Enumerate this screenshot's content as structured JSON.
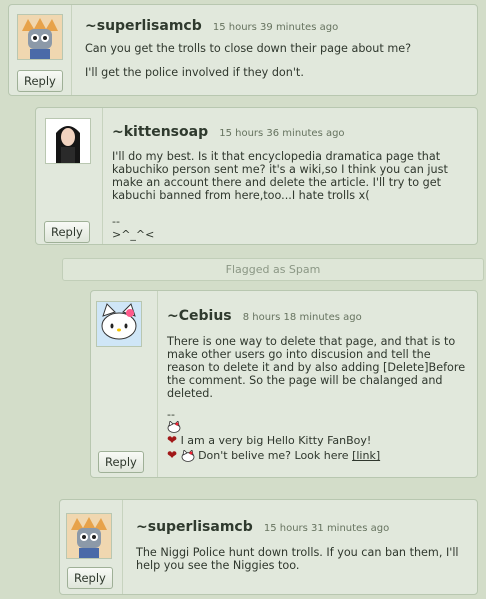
{
  "comments": [
    {
      "username": "~superlisamcb",
      "time": "15 hours 39 minutes ago",
      "lines": [
        "Can you get the trolls to close down their page about me?",
        "I'll get the police involved if they don't."
      ],
      "reply_label": "Reply",
      "avatar_icon": "robot-avatar"
    },
    {
      "username": "~kittensoap",
      "time": "15 hours 36 minutes ago",
      "text": "I'll do my best. Is it that encyclopedia dramatica page that kabuchiko person sent me? it's a wiki,so I think you can just make an account there and delete the article. I'll try to get kabuchi banned from here,too...I hate trolls x(",
      "sig_dash": "--",
      "sig_face": ">^_^<",
      "reply_label": "Reply",
      "avatar_icon": "dark-hair-avatar"
    },
    {
      "username": "~Cebius",
      "time": "8 hours 18 minutes ago",
      "text": "There is one way to delete that page, and that is to make other users go into discusion and tell the reason to delete it and by also adding [Delete]Before the comment. So the page will be chalanged and deleted.",
      "sig_dash": "--",
      "sig_line1": "I am a very big Hello Kitty FanBoy!",
      "sig_line2": "Don't belive me? Look here",
      "sig_link": "[link]",
      "reply_label": "Reply",
      "avatar_icon": "hello-kitty-avatar"
    },
    {
      "username": "~superlisamcb",
      "time": "15 hours 31 minutes ago",
      "text": "The Niggi Police hunt down trolls. If you can ban them, I'll help you see the Niggies too.",
      "reply_label": "Reply",
      "avatar_icon": "robot-avatar"
    }
  ],
  "flagged_label": "Flagged as Spam",
  "colors": {
    "heart": "#a11818",
    "background": "#d3ddc9",
    "comment_bg": "#e1e8dc"
  }
}
